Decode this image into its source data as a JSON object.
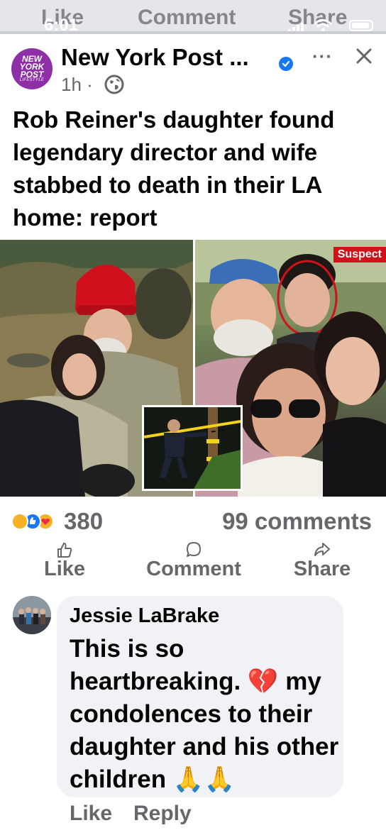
{
  "status_bar": {
    "time": "6:01"
  },
  "previous_post_actions": {
    "like": "Like",
    "comment": "Comment",
    "share": "Share"
  },
  "post": {
    "avatar": {
      "line1": "NEW",
      "line2": "YORK",
      "line3": "POST",
      "line4": "LIFESTYLE"
    },
    "page_name": "New York Post ...",
    "time_ago": "1h ·",
    "more_label": "···",
    "headline": "Rob Reiner's daughter found legendary director and wife stabbed to death in their LA home: report",
    "image": {
      "suspect_tag": "Suspect"
    },
    "reaction_count": "380",
    "comment_count": "99 comments",
    "actions": {
      "like": "Like",
      "comment": "Comment",
      "share": "Share"
    }
  },
  "comment": {
    "author": "Jessie LaBrake",
    "text": "This is so heartbreaking. 💔 my condolences to their daughter and his other children 🙏🙏",
    "actions": {
      "like": "Like",
      "reply": "Reply"
    }
  },
  "colors": {
    "brand_purple": "#8e2fa8",
    "verified_blue": "#1877f2",
    "secondary_text": "#65676b",
    "bubble": "#f0f2f5",
    "suspect_red": "#d0121b"
  },
  "icons": [
    "globe-icon",
    "verified-icon",
    "more-icon",
    "close-icon",
    "like-icon",
    "comment-icon",
    "share-icon",
    "sad-reaction-icon",
    "like-reaction-icon",
    "care-reaction-icon"
  ]
}
